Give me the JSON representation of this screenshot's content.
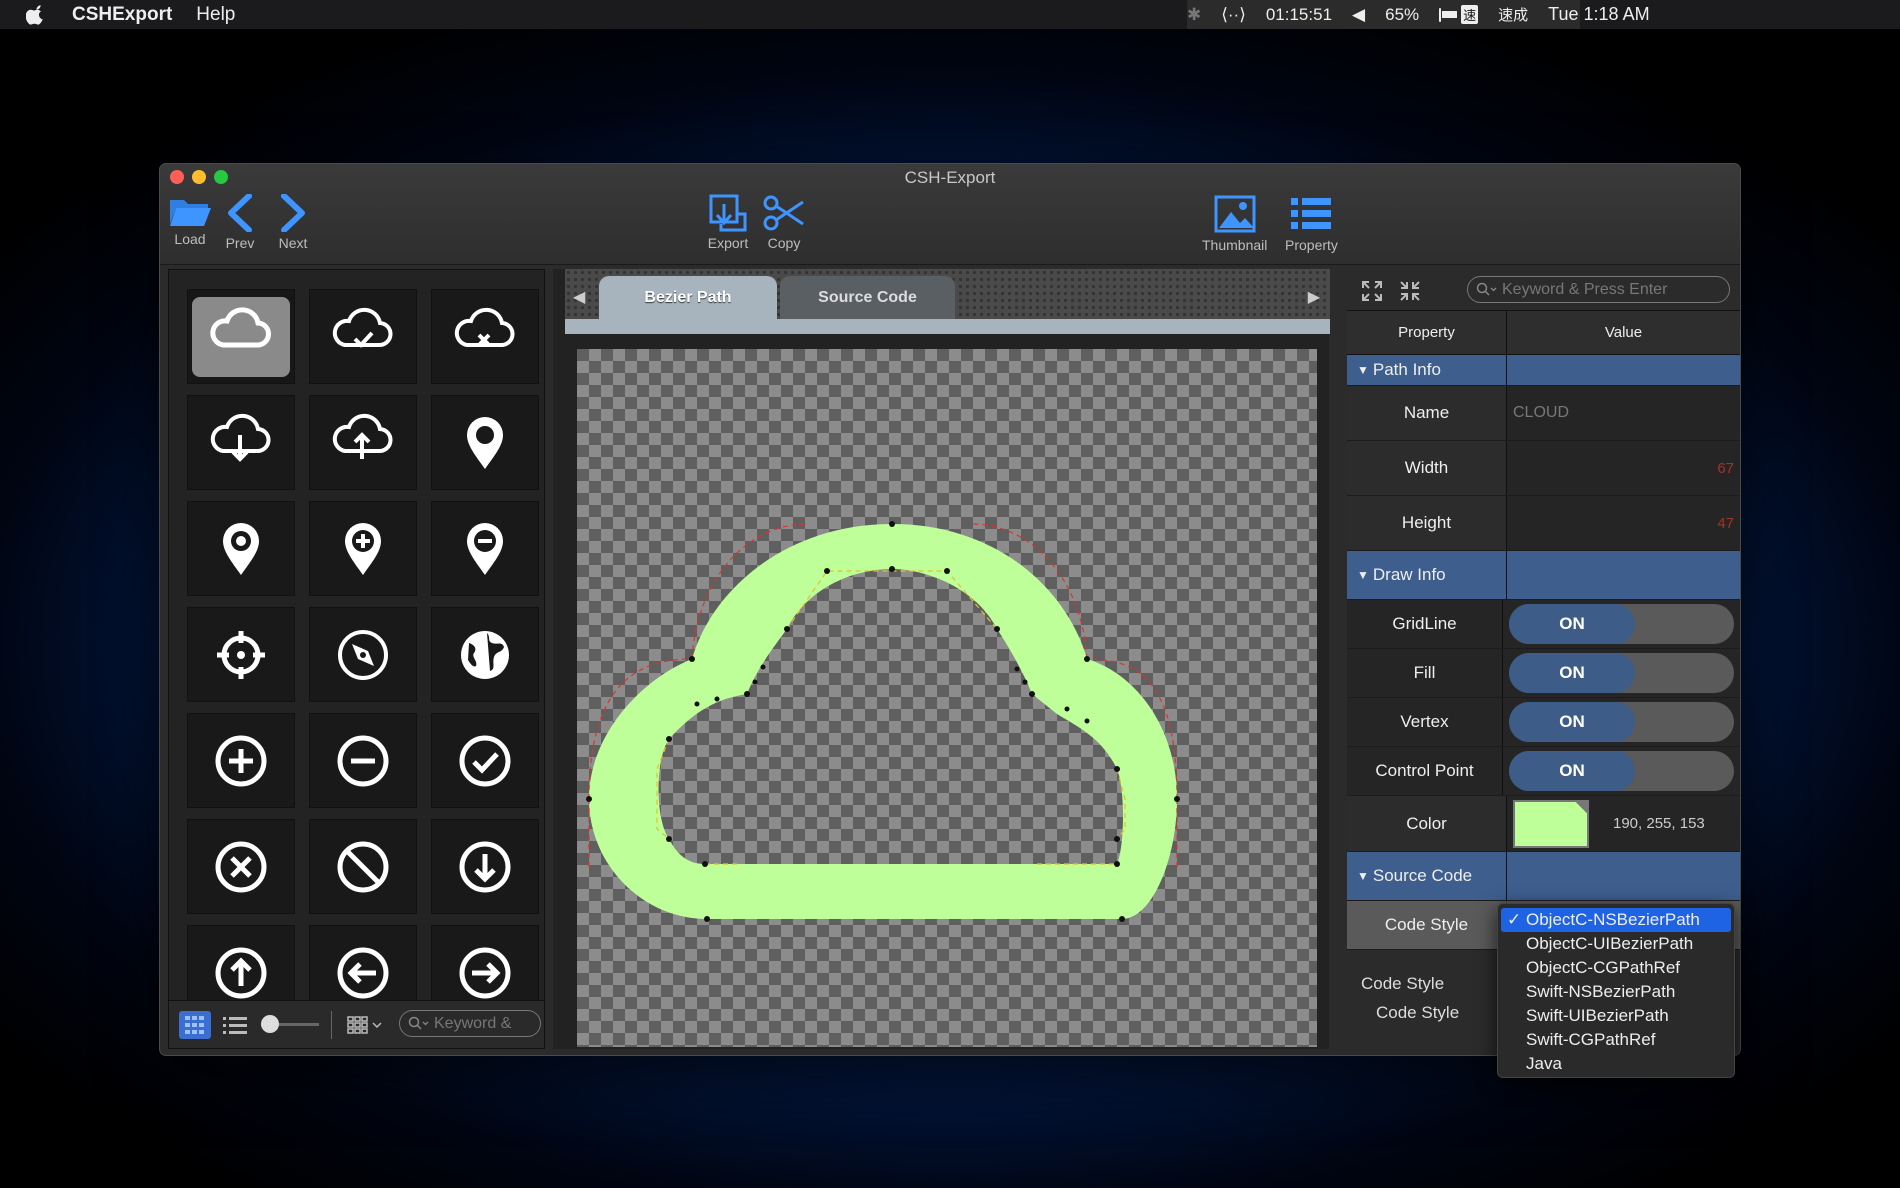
{
  "menubar": {
    "app_name": "CSHExport",
    "menu_help": "Help",
    "timer": "01:15:51",
    "battery": "65%",
    "input_method": "速成",
    "clock": "Tue 1:18 AM"
  },
  "window": {
    "title": "CSH-Export",
    "toolbar": {
      "load": "Load",
      "prev": "Prev",
      "next": "Next",
      "export": "Export",
      "copy": "Copy",
      "thumbnail": "Thumbnail",
      "property": "Property"
    }
  },
  "library": {
    "search_placeholder": "Keyword &",
    "icons": [
      "cloud",
      "cloud-check",
      "cloud-x",
      "cloud-download",
      "cloud-upload",
      "pin",
      "pin-dot",
      "pin-plus",
      "pin-minus",
      "crosshair",
      "compass",
      "globe",
      "circle-plus",
      "circle-minus",
      "circle-check",
      "circle-x",
      "circle-ban",
      "circle-arrow-down",
      "circle-arrow-up",
      "circle-arrow-left",
      "circle-arrow-right"
    ]
  },
  "editor": {
    "tab_bezier": "Bezier Path",
    "tab_source": "Source Code",
    "fill_color": "#beff99"
  },
  "properties": {
    "search_placeholder": "Keyword & Press Enter",
    "col_property": "Property",
    "col_value": "Value",
    "sec_path": "Path Info",
    "name_label": "Name",
    "name_value": "CLOUD",
    "width_label": "Width",
    "width_value": "67",
    "height_label": "Height",
    "height_value": "47",
    "sec_draw": "Draw Info",
    "gridline_label": "GridLine",
    "fill_label": "Fill",
    "vertex_label": "Vertex",
    "control_label": "Control Point",
    "on": "ON",
    "color_label": "Color",
    "color_value": "190, 255, 153",
    "sec_source": "Source Code",
    "codestyle_label": "Code Style",
    "bottom_label_1": "Code Style",
    "bottom_label_2": "Code Style"
  },
  "code_style_menu": {
    "selected": "ObjectC-NSBezierPath",
    "options": [
      "ObjectC-NSBezierPath",
      "ObjectC-UIBezierPath",
      "ObjectC-CGPathRef",
      "Swift-NSBezierPath",
      "Swift-UIBezierPath",
      "Swift-CGPathRef",
      "Java"
    ]
  }
}
